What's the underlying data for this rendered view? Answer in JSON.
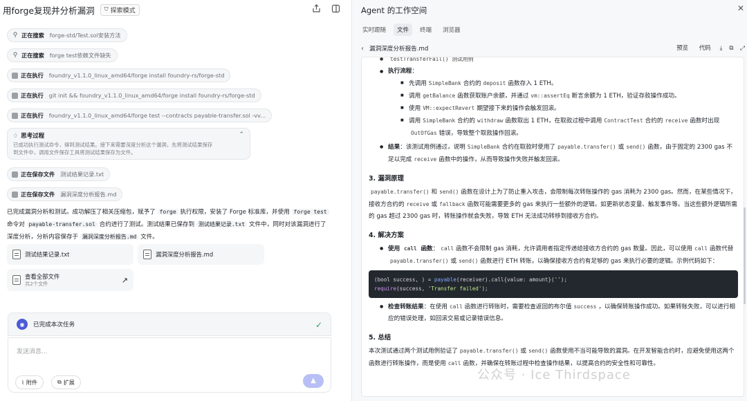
{
  "left": {
    "title": "用forge复现并分析漏洞",
    "badge": "探索模式",
    "steps": [
      {
        "icon": "search-icon",
        "label": "正在搜索",
        "text": "forge-std/Test.sol安装方法"
      },
      {
        "icon": "search-icon",
        "label": "正在搜索",
        "text": "forge test依赖文件缺失"
      },
      {
        "icon": "terminal-icon",
        "label": "正在执行",
        "text": "foundry_v1.1.0_linux_amd64/forge install foundry-rs/forge-std"
      },
      {
        "icon": "terminal-icon",
        "label": "正在执行",
        "text": "git init && foundry_v1.1.0_linux_amd64/forge install foundry-rs/forge-std"
      },
      {
        "icon": "terminal-icon",
        "label": "正在执行",
        "text": "foundry_v1.1.0_linux_amd64/forge test --contracts payable-transfer.sol -vv..."
      }
    ],
    "think": {
      "title": "思考过程",
      "line1": "已成功执行测试命令，得到测试结果。接下来需要深度分析这个漏洞，先将测试结果保存",
      "line2": "到文件中，调用文件保存工具将测试结果保存为文件。"
    },
    "saves": [
      {
        "label": "正在保存文件",
        "text": "测试结果记录.txt"
      },
      {
        "label": "正在保存文件",
        "text": "漏洞深度分析报告.md"
      }
    ],
    "summary": {
      "p1": "已完成漏洞分析和测试。成功解压了相关压缩包，赋予了",
      "c1": "forge",
      "p2": "执行权限，安装了 Forge 标准库，并使用",
      "c2": "forge test",
      "p3": "命令对",
      "c3": "payable-transfer.sol",
      "p4": "合约进行了测试。测试结果已保存到",
      "c4": "测试结果记录.txt",
      "p5": "文件",
      "p6": "中，同时对该漏洞进行了深度分析，分析内容保存于",
      "c5": "漏洞深度分析报告.md",
      "p7": "文件。"
    },
    "files": [
      {
        "name": "测试结果记录.txt"
      },
      {
        "name": "漏洞深度分析报告.md"
      }
    ],
    "all_files": {
      "label": "查看全部文件",
      "sub": "共2个文件"
    },
    "task_done": "已完成本次任务",
    "input_placeholder": "发送消息...",
    "attach_label": "附件",
    "extend_label": "扩展"
  },
  "right": {
    "title": "Agent 的工作空间",
    "tabs": [
      "实时跟随",
      "文件",
      "终端",
      "浏览器"
    ],
    "active_tab": "文件",
    "file_name": "漏洞深度分析报告.md",
    "preview_label": "预览",
    "code_label": "代码",
    "doc": {
      "partial_heading": "testTransferFail() 测试用例",
      "exec_flow": "执行流程",
      "flow": [
        [
          "先调用",
          "SimpleBank",
          "合约的",
          "deposit",
          "函数存入 1 ETH。"
        ],
        [
          "调用",
          "getBalance",
          "函数获取账户余额，并通过",
          "vm::assertEq",
          "断言余额为 1 ETH，验证存款操作成功。"
        ],
        [
          "使用",
          "VM::expectRevert",
          "期望接下来的操作会触发回滚。"
        ],
        [
          "调用",
          "SimpleBank",
          "合约的",
          "withdraw",
          "函数取出 1 ETH，在取款过程中调用",
          "ContractTest",
          "合约的",
          "receive",
          "函数时出现",
          "OutOfGas",
          "错误，导致整个取款操作回滚。"
        ]
      ],
      "result_label": "结果",
      "result": [
        "该测试用例通过，说明",
        "SimpleBank",
        "合约在取款时使用了",
        "payable.transfer()",
        "或",
        "send()",
        "函数，由于固定的 2300 gas 不足以完成",
        "receive",
        "函数中的操作，从而导致操作失败并触发回滚。"
      ],
      "h3": "3. 漏洞原理",
      "principle": [
        "payable.transfer()",
        "和",
        "send()",
        "函数在设计上为了防止重入攻击，会限制每次转账操作的 gas 消耗为 2300 gas。然而，在某些情况下，接收方合约的",
        "receive",
        "或",
        "fallback",
        "函数可能需要更多的 gas 来执行一些额外的逻辑，如更新状态变量、触发事件等。当这些额外逻辑所需的 gas 超过 2300 gas 时，转账操作就会失败，导致 ETH 无法成功转移到接收方合约。"
      ],
      "h4": "4. 解决方案",
      "sol1_label": "使用",
      "sol1_code": "call",
      "sol1_label2": "函数",
      "sol1": [
        "call",
        "函数不会限制 gas 消耗，允许调用者指定传递给接收方合约的 gas 数量。因此，可以使用",
        "call",
        "函数代替",
        "payable.transfer()",
        "或",
        "send()",
        "函数进行 ETH 转账，以确保接收方合约有足够的 gas 来执行必要的逻辑。示例代码如下："
      ],
      "code_line1": {
        "a": "(bool success, ) = ",
        "b": "payable",
        "c": "(receiver).call{value: amount}(",
        "d": "''",
        "e": ");"
      },
      "code_line2": {
        "a": "require",
        "b": "(success, ",
        "c": "'Transfer failed'",
        "d": ");"
      },
      "sol2_label": "检查转账结果",
      "sol2": [
        "在使用",
        "call",
        "函数进行转账时，需要检查返回的布尔值",
        "success",
        "，以确保转账操作成功。如果转账失败，可以进行相应的错误处理，如回滚交易或记录错误信息。"
      ],
      "h5": "5. 总结",
      "summary": [
        "本次测试通过两个测试用例验证了",
        "payable.transfer()",
        "或",
        "send()",
        "函数使用不当可能导致的漏洞。在开发智能合约时，应避免使用这两个函数进行转账操作，而是使用",
        "call",
        "函数，并确保在转账过程中检查操作结果，以提高合约的安全性和可靠性。"
      ]
    }
  },
  "watermark": "公众号 · Ice Thirdspace"
}
